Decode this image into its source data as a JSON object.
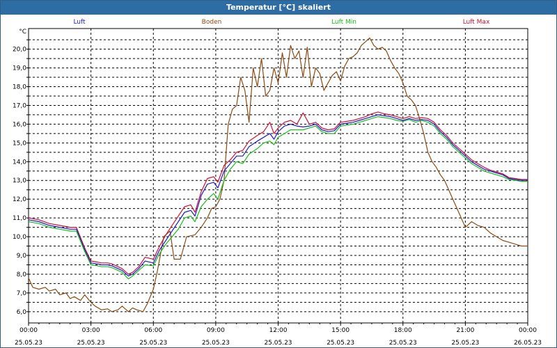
{
  "window": {
    "title": "Temperatur [°C] skaliert"
  },
  "colors": {
    "luft": "#1a1ad0",
    "boden": "#8b4a10",
    "luft_min": "#18c018",
    "luft_max": "#d01030",
    "titlebar": "#2e6da4"
  },
  "chart_data": {
    "type": "line",
    "title": "Temperatur [°C] skaliert",
    "ylabel": "°C",
    "xlim": [
      0,
      24
    ],
    "ylim": [
      5.4,
      21.1
    ],
    "grid": true,
    "legend_placement": "top",
    "y_ticks": [
      "6,0",
      "6,5",
      "7,0",
      "7,5",
      "8,0",
      "8,5",
      "9,0",
      "9,5",
      "10,0",
      "10,5",
      "11,0",
      "11,5",
      "12,0",
      "12,5",
      "13,0",
      "13,5",
      "14,0",
      "14,5",
      "15,0",
      "15,5",
      "16,0",
      "16,5",
      "17,0",
      "17,5",
      "18,0",
      "18,5",
      "19,0",
      "19,5",
      "20,0",
      "20,5"
    ],
    "y_tick_values": [
      6.0,
      6.5,
      7.0,
      7.5,
      8.0,
      8.5,
      9.0,
      9.5,
      10.0,
      10.5,
      11.0,
      11.5,
      12.0,
      12.5,
      13.0,
      13.5,
      14.0,
      14.5,
      15.0,
      15.5,
      16.0,
      16.5,
      17.0,
      17.5,
      18.0,
      18.5,
      19.0,
      19.5,
      20.0,
      20.5
    ],
    "x_ticks": [
      {
        "time": "00:00",
        "date": "25.05.23"
      },
      {
        "time": "03:00",
        "date": "25.05.23"
      },
      {
        "time": "06:00",
        "date": "25.05.23"
      },
      {
        "time": "09:00",
        "date": "25.05.23"
      },
      {
        "time": "12:00",
        "date": "25.05.23"
      },
      {
        "time": "15:00",
        "date": "25.05.23"
      },
      {
        "time": "18:00",
        "date": "25.05.23"
      },
      {
        "time": "21:00",
        "date": "25.05.23"
      },
      {
        "time": "00:00",
        "date": "26.05.23"
      }
    ],
    "x_tick_hours": [
      0,
      3,
      6,
      9,
      12,
      15,
      18,
      21,
      24
    ],
    "series": [
      {
        "name": "Luft",
        "x": [
          0,
          0.5,
          1,
          1.5,
          2,
          2.3,
          2.7,
          3,
          3.3,
          3.5,
          3.8,
          4,
          4.3,
          4.5,
          4.8,
          5,
          5.3,
          5.6,
          6,
          6.3,
          6.6,
          6.9,
          7.2,
          7.5,
          7.8,
          8,
          8.3,
          8.6,
          8.9,
          9.1,
          9.4,
          9.7,
          10,
          10.3,
          10.6,
          11,
          11.3,
          11.6,
          11.8,
          12,
          12.3,
          12.6,
          12.9,
          13.2,
          13.5,
          13.8,
          14.1,
          14.4,
          14.7,
          15,
          15.3,
          15.6,
          15.9,
          16.2,
          16.5,
          16.8,
          17.1,
          17.4,
          17.7,
          18,
          18.3,
          18.6,
          18.9,
          19.2,
          19.5,
          19.8,
          20.1,
          20.4,
          20.7,
          21,
          21.3,
          21.6,
          21.9,
          22.2,
          22.5,
          22.8,
          23.1,
          23.4,
          23.7,
          24
        ],
        "y": [
          10.9,
          10.8,
          10.6,
          10.5,
          10.4,
          10.4,
          9.3,
          8.6,
          8.55,
          8.5,
          8.5,
          8.45,
          8.3,
          8.2,
          7.9,
          8.0,
          8.3,
          8.7,
          8.6,
          9.3,
          9.8,
          10.3,
          10.8,
          11.3,
          11.4,
          11.1,
          12.2,
          12.8,
          12.9,
          12.6,
          13.5,
          13.9,
          14.3,
          14.3,
          14.8,
          15.1,
          15.3,
          15.5,
          15.2,
          15.6,
          15.9,
          16.0,
          15.9,
          15.85,
          15.9,
          16.0,
          15.7,
          15.6,
          15.65,
          16.0,
          16.05,
          16.1,
          16.2,
          16.3,
          16.4,
          16.5,
          16.45,
          16.4,
          16.3,
          16.2,
          16.3,
          16.2,
          16.25,
          16.2,
          16.0,
          15.6,
          15.3,
          14.9,
          14.6,
          14.3,
          14.0,
          13.8,
          13.6,
          13.5,
          13.4,
          13.3,
          13.1,
          13.05,
          13.0,
          13.0
        ]
      },
      {
        "name": "Boden",
        "x": [
          0,
          0.2,
          0.5,
          0.8,
          1,
          1.3,
          1.5,
          1.8,
          2,
          2.2,
          2.5,
          2.7,
          3,
          3.2,
          3.5,
          3.8,
          4,
          4.3,
          4.5,
          4.8,
          5,
          5.2,
          5.5,
          5.7,
          6,
          6.2,
          6.5,
          6.8,
          7,
          7.3,
          7.6,
          8,
          8.3,
          8.6,
          8.8,
          9,
          9.2,
          9.4,
          9.6,
          9.8,
          10,
          10.2,
          10.4,
          10.6,
          10.8,
          11,
          11.2,
          11.4,
          11.6,
          11.8,
          12,
          12.2,
          12.4,
          12.6,
          12.8,
          13,
          13.2,
          13.4,
          13.6,
          13.8,
          14,
          14.2,
          14.4,
          14.6,
          14.8,
          15,
          15.2,
          15.4,
          15.6,
          15.8,
          16,
          16.2,
          16.4,
          16.6,
          16.8,
          17,
          17.2,
          17.4,
          17.6,
          17.8,
          18,
          18.2,
          18.4,
          18.6,
          18.8,
          19,
          19.2,
          19.4,
          19.6,
          19.8,
          20,
          20.2,
          20.4,
          20.6,
          20.8,
          21,
          21.3,
          21.6,
          21.9,
          22.2,
          22.5,
          22.8,
          23.1,
          23.4,
          23.7,
          24
        ],
        "y": [
          7.8,
          7.3,
          7.2,
          7.3,
          7.1,
          7.2,
          6.9,
          7.0,
          6.7,
          6.8,
          6.6,
          6.9,
          6.5,
          6.3,
          6.1,
          6.15,
          6.0,
          6.1,
          6.3,
          6.0,
          6.2,
          6.1,
          6.0,
          6.4,
          7.2,
          8.2,
          10.0,
          10.3,
          8.8,
          8.8,
          10.0,
          10.1,
          10.5,
          11.0,
          11.5,
          11.6,
          12.0,
          13.0,
          16.0,
          16.8,
          17.0,
          18.5,
          17.8,
          16.1,
          19.0,
          18.0,
          19.5,
          17.5,
          17.8,
          19.0,
          18.2,
          19.8,
          18.5,
          20.2,
          19.5,
          19.9,
          18.5,
          20.1,
          18.0,
          19.0,
          18.7,
          17.8,
          18.2,
          18.6,
          18.8,
          18.3,
          19.1,
          19.5,
          19.6,
          19.8,
          20.2,
          20.4,
          20.6,
          20.2,
          20.0,
          20.1,
          19.9,
          19.4,
          19.0,
          18.7,
          18.2,
          17.5,
          17.3,
          17.0,
          16.3,
          15.5,
          14.5,
          14.0,
          13.7,
          13.3,
          13.0,
          12.5,
          12.0,
          11.5,
          11.0,
          10.5,
          10.8,
          10.6,
          10.5,
          10.2,
          10.0,
          9.8,
          9.7,
          9.6,
          9.5,
          9.5
        ]
      },
      {
        "name": "Luft Min",
        "x": [
          0,
          0.5,
          1,
          1.5,
          2,
          2.3,
          2.7,
          3,
          3.3,
          3.5,
          3.8,
          4,
          4.3,
          4.5,
          4.8,
          5,
          5.3,
          5.6,
          6,
          6.3,
          6.6,
          6.9,
          7.2,
          7.5,
          7.8,
          8,
          8.3,
          8.6,
          8.9,
          9.1,
          9.4,
          9.7,
          10,
          10.3,
          10.6,
          11,
          11.3,
          11.6,
          11.8,
          12,
          12.3,
          12.6,
          12.9,
          13.2,
          13.5,
          13.8,
          14.1,
          14.4,
          14.7,
          15,
          15.3,
          15.6,
          15.9,
          16.2,
          16.5,
          16.8,
          17.1,
          17.4,
          17.7,
          18,
          18.3,
          18.6,
          18.9,
          19.2,
          19.5,
          19.8,
          20.1,
          20.4,
          20.7,
          21,
          21.3,
          21.6,
          21.9,
          22.2,
          22.5,
          22.8,
          23.1,
          23.4,
          23.7,
          24
        ],
        "y": [
          10.8,
          10.7,
          10.5,
          10.4,
          10.3,
          10.3,
          9.2,
          8.5,
          8.45,
          8.4,
          8.4,
          8.35,
          8.2,
          8.1,
          7.75,
          7.9,
          8.2,
          8.5,
          8.45,
          9.1,
          9.6,
          10.0,
          10.4,
          11.0,
          11.1,
          10.8,
          11.6,
          12.0,
          12.3,
          12.0,
          13.0,
          13.6,
          14.0,
          13.9,
          14.4,
          14.7,
          15.0,
          15.1,
          14.9,
          15.3,
          15.5,
          15.7,
          15.7,
          15.7,
          15.8,
          15.9,
          15.6,
          15.5,
          15.5,
          15.9,
          15.95,
          16.0,
          16.1,
          16.2,
          16.3,
          16.4,
          16.35,
          16.3,
          16.2,
          16.15,
          16.25,
          16.1,
          16.2,
          16.1,
          15.9,
          15.5,
          15.2,
          14.8,
          14.5,
          14.2,
          13.9,
          13.7,
          13.5,
          13.4,
          13.3,
          13.2,
          13.05,
          13.0,
          12.95,
          12.95
        ]
      },
      {
        "name": "Luft Max",
        "x": [
          0,
          0.5,
          1,
          1.5,
          2,
          2.3,
          2.7,
          3,
          3.3,
          3.5,
          3.8,
          4,
          4.3,
          4.5,
          4.8,
          5,
          5.3,
          5.6,
          6,
          6.3,
          6.6,
          6.9,
          7.2,
          7.5,
          7.8,
          8,
          8.3,
          8.6,
          8.9,
          9.1,
          9.4,
          9.7,
          10,
          10.3,
          10.6,
          11,
          11.3,
          11.6,
          11.8,
          12,
          12.3,
          12.6,
          12.9,
          13.2,
          13.5,
          13.8,
          14.1,
          14.4,
          14.7,
          15,
          15.3,
          15.6,
          15.9,
          16.2,
          16.5,
          16.8,
          17.1,
          17.4,
          17.7,
          18,
          18.3,
          18.6,
          18.9,
          19.2,
          19.5,
          19.8,
          20.1,
          20.4,
          20.7,
          21,
          21.3,
          21.6,
          21.9,
          22.2,
          22.5,
          22.8,
          23.1,
          23.4,
          23.7,
          24
        ],
        "y": [
          11.0,
          10.9,
          10.7,
          10.6,
          10.5,
          10.5,
          9.4,
          8.7,
          8.65,
          8.6,
          8.6,
          8.55,
          8.4,
          8.3,
          8.0,
          8.1,
          8.4,
          8.9,
          8.8,
          9.5,
          10.1,
          10.6,
          11.1,
          11.6,
          11.7,
          11.3,
          12.4,
          13.1,
          13.2,
          12.9,
          13.8,
          14.1,
          14.5,
          14.6,
          15.1,
          15.4,
          15.6,
          16.1,
          15.5,
          15.8,
          16.1,
          16.2,
          16.0,
          16.6,
          16.0,
          16.1,
          15.8,
          15.7,
          15.75,
          16.1,
          16.15,
          16.2,
          16.3,
          16.4,
          16.55,
          16.65,
          16.55,
          16.5,
          16.4,
          16.3,
          16.4,
          16.3,
          16.35,
          16.3,
          16.1,
          15.7,
          15.4,
          15.0,
          14.7,
          14.4,
          14.1,
          13.9,
          13.7,
          13.55,
          13.45,
          13.35,
          13.15,
          13.1,
          13.05,
          13.05
        ]
      }
    ]
  }
}
